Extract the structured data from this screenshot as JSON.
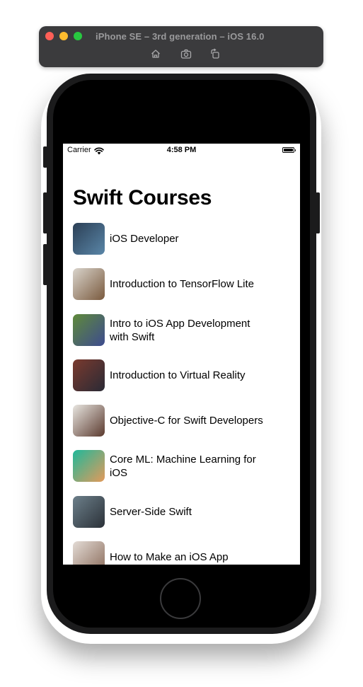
{
  "simulator": {
    "title": "iPhone SE – 3rd generation – iOS 16.0",
    "buttons": [
      "home-icon",
      "screenshot-icon",
      "rotate-icon"
    ]
  },
  "status_bar": {
    "carrier": "Carrier",
    "time": "4:58 PM"
  },
  "screen": {
    "title": "Swift Courses",
    "courses": [
      {
        "title": "iOS Developer",
        "thumb_colors": [
          "#2b3f55",
          "#5a86a8"
        ]
      },
      {
        "title": "Introduction to TensorFlow Lite",
        "thumb_colors": [
          "#d9d4cc",
          "#7a5a3e"
        ]
      },
      {
        "title": "Intro to iOS App Development with Swift",
        "thumb_colors": [
          "#5f8a3a",
          "#3d4b8f"
        ]
      },
      {
        "title": "Introduction to Virtual Reality",
        "thumb_colors": [
          "#7a3a2e",
          "#2a2a35"
        ]
      },
      {
        "title": "Objective-C for Swift Developers",
        "thumb_colors": [
          "#e8e6e1",
          "#5b3a2e"
        ]
      },
      {
        "title": "Core ML: Machine Learning for iOS",
        "thumb_colors": [
          "#1fb89a",
          "#e39a5a"
        ]
      },
      {
        "title": "Server-Side Swift",
        "thumb_colors": [
          "#6c7f8a",
          "#2b3138"
        ]
      },
      {
        "title": "How to Make an iOS App",
        "thumb_colors": [
          "#e4dcd6",
          "#8a6b5a"
        ]
      }
    ]
  }
}
